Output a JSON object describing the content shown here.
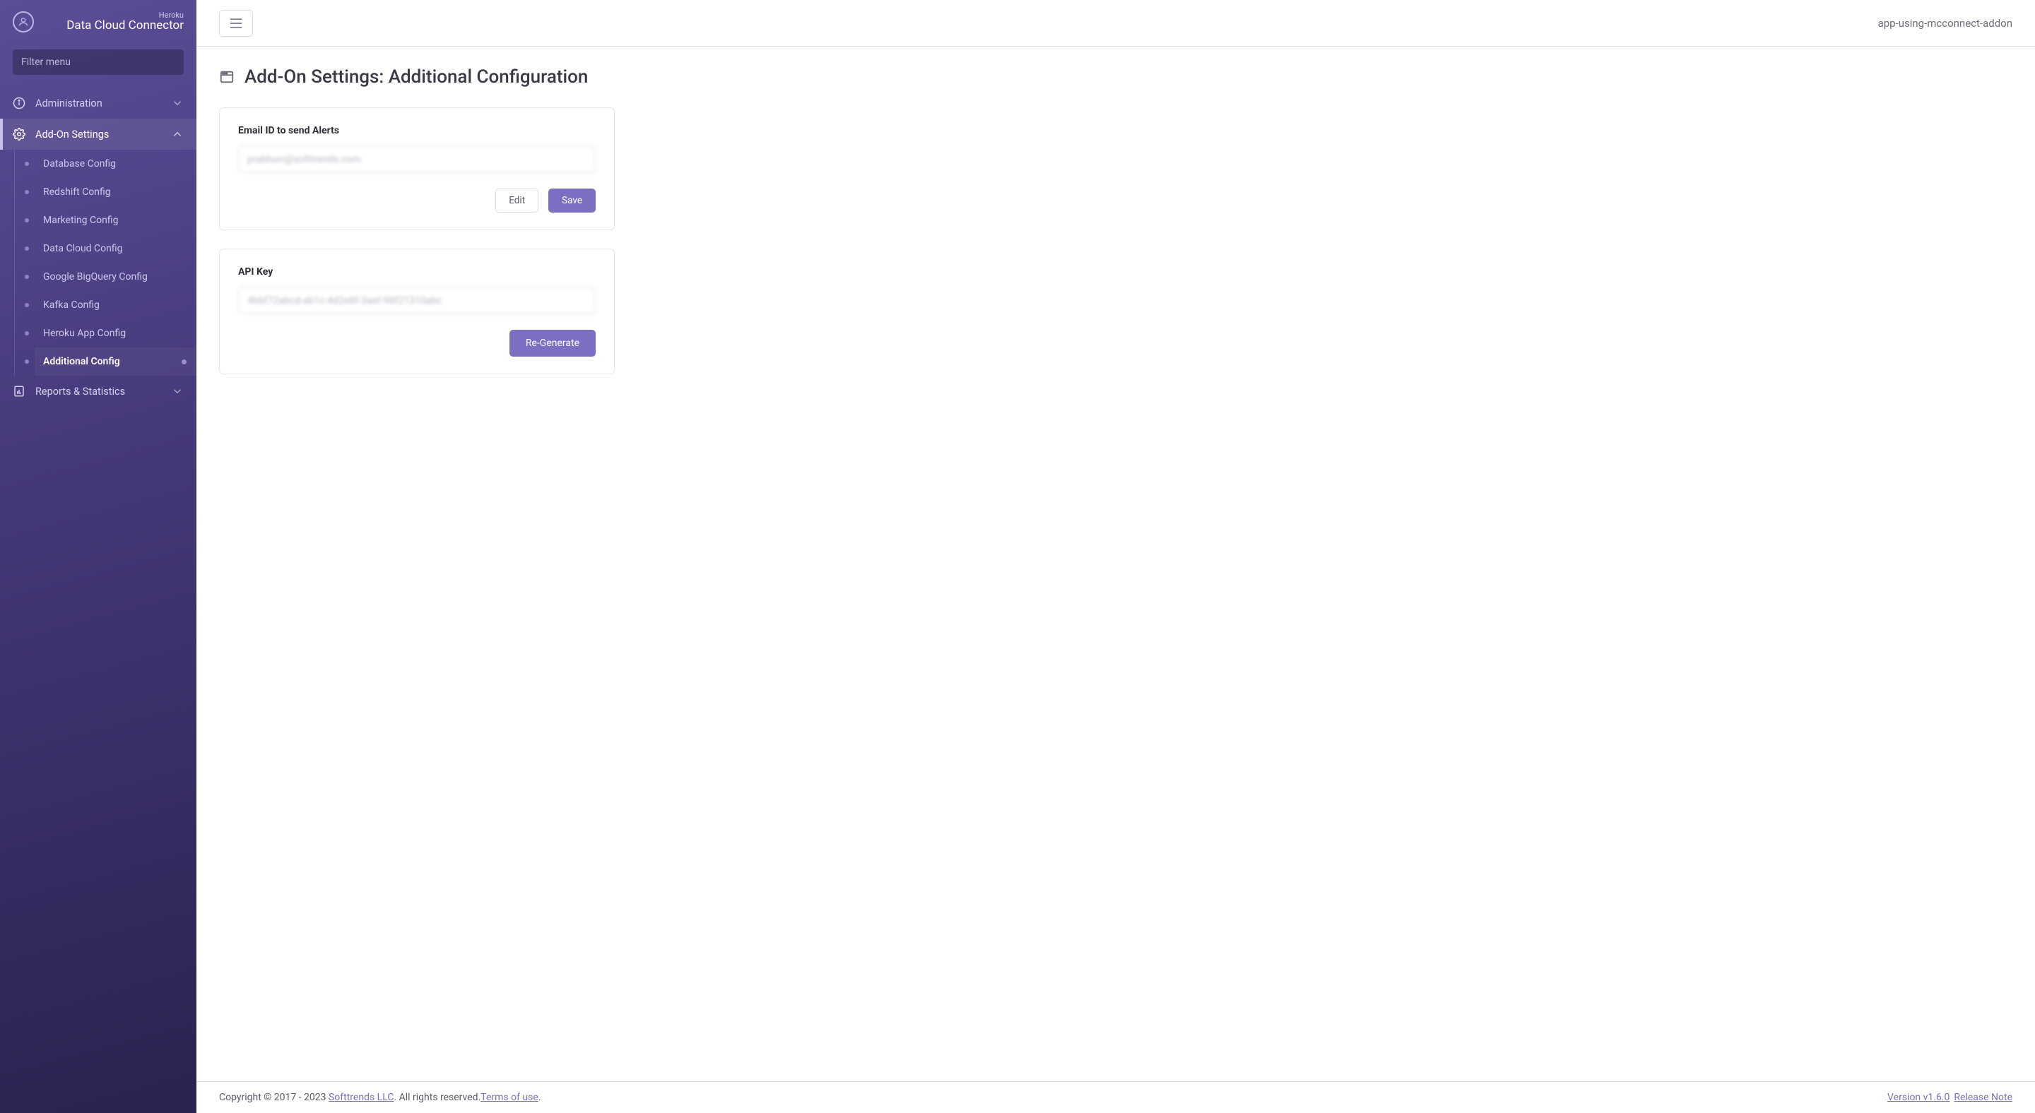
{
  "brand": {
    "super": "Heroku",
    "title": "Data Cloud Connector"
  },
  "filter": {
    "placeholder": "Filter menu"
  },
  "menu": {
    "administration": "Administration",
    "addon_settings": "Add-On Settings",
    "sub": {
      "database": "Database Config",
      "redshift": "Redshift Config",
      "marketing": "Marketing Config",
      "datacloud": "Data Cloud Config",
      "bigquery": "Google BigQuery Config",
      "kafka": "Kafka Config",
      "herokuapp": "Heroku App Config",
      "additional": "Additional Config"
    },
    "reports": "Reports & Statistics"
  },
  "topbar": {
    "app_name": "app-using-mcconnect-addon"
  },
  "page": {
    "title": "Add-On Settings: Additional Configuration"
  },
  "email_card": {
    "label": "Email ID to send Alerts",
    "value": "prabhurr@softtrends.com",
    "edit": "Edit",
    "save": "Save"
  },
  "api_card": {
    "label": "API Key",
    "value": "4b6f72abcd-ab1c-4d2e8f-3aef-98f21310abc",
    "regenerate": "Re-Generate"
  },
  "footer": {
    "copyright_prefix": "Copyright © 2017 - 2023 ",
    "company": "Softtrends LLC",
    "rights": ". All rights reserved.",
    "terms": "Terms of use",
    "dot": ".",
    "version_label": "Version v1.6.0",
    "release": " Release Note"
  }
}
